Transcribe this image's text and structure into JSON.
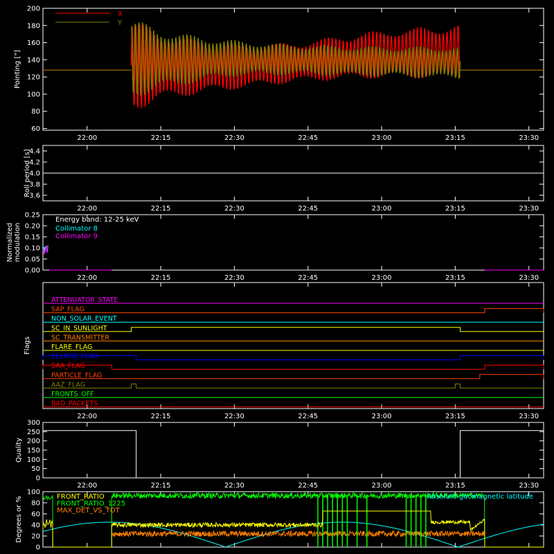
{
  "colors": {
    "background": "#000000",
    "axis": "#ffffff",
    "red": "#ff0000",
    "olive": "#808000",
    "cyan": "#00ffff",
    "magenta": "#ff00ff",
    "yellow": "#ffff00",
    "green": "#00ff00",
    "orange": "#ff8000",
    "blue": "#0000ff",
    "orangered": "#ff4500"
  },
  "time_axis": {
    "range": [
      "21:51",
      "23:33"
    ],
    "ticks": [
      "22:00",
      "22:15",
      "22:30",
      "22:45",
      "23:00",
      "23:15",
      "23:30"
    ]
  },
  "chart_data": [
    {
      "id": "pointing",
      "type": "line",
      "ylabel": "Pointing [\"]",
      "ylim": [
        58,
        200
      ],
      "yticks": [
        "60",
        "80",
        "100",
        "120",
        "140",
        "160",
        "180",
        "200"
      ],
      "legend": "top-left",
      "series": [
        {
          "name": "X",
          "color": "#ff0000",
          "baseline": 128,
          "active_start": "22:09",
          "active_end": "23:16",
          "upper_env": [
            [
              22.15,
              186
            ],
            [
              22.3,
              168
            ],
            [
              22.5,
              158
            ],
            [
              22.7,
              160
            ],
            [
              22.85,
              168
            ],
            [
              23.0,
              175
            ],
            [
              23.2,
              180
            ],
            [
              23.25,
              182
            ]
          ],
          "lower_env": [
            [
              22.15,
              80
            ],
            [
              22.3,
              95
            ],
            [
              22.5,
              105
            ],
            [
              22.7,
              113
            ],
            [
              22.85,
              116
            ],
            [
              23.0,
              118
            ],
            [
              23.2,
              118
            ],
            [
              23.25,
              118
            ]
          ]
        },
        {
          "name": "Y",
          "color": "#808000",
          "baseline": 128,
          "active_start": "22:09",
          "active_end": "23:16",
          "upper_env": [
            [
              22.15,
              188
            ],
            [
              22.3,
              172
            ],
            [
              22.5,
              163
            ],
            [
              22.7,
              158
            ],
            [
              22.85,
              157
            ],
            [
              23.0,
              156
            ],
            [
              23.2,
              156
            ],
            [
              23.25,
              156
            ]
          ],
          "lower_env": [
            [
              22.15,
              95
            ],
            [
              22.3,
              108
            ],
            [
              22.5,
              120
            ],
            [
              22.7,
              122
            ],
            [
              22.85,
              121
            ],
            [
              23.0,
              120
            ],
            [
              23.2,
              118
            ],
            [
              23.25,
              117
            ]
          ]
        }
      ]
    },
    {
      "id": "roll",
      "type": "line",
      "ylabel": "Roll period [s]",
      "ylim": [
        3.5,
        4.5
      ],
      "yticks": [
        "3.6",
        "3.8",
        "4.0",
        "4.2",
        "4.4"
      ],
      "series": [
        {
          "name": "",
          "color": "#ffffff",
          "value": 4.0
        }
      ]
    },
    {
      "id": "modulation",
      "type": "line",
      "ylabel_line1": "Normalized",
      "ylabel_line2": "modulation",
      "ylim": [
        0,
        0.25
      ],
      "yticks": [
        "0.00",
        "0.05",
        "0.10",
        "0.15",
        "0.20",
        "0.25"
      ],
      "annotation": "Energy band: 12-25 keV",
      "legend": "top-left",
      "active_ranges": [
        [
          "21:51",
          "21:52"
        ],
        [
          "22:05",
          "23:21"
        ]
      ],
      "series": [
        {
          "name": "Collimator 8",
          "color": "#00ffff",
          "mean": 0.095,
          "spread": 0.022
        },
        {
          "name": "Collimator 9",
          "color": "#ff00ff",
          "mean": 0.092,
          "spread": 0.02
        }
      ]
    },
    {
      "id": "flags",
      "type": "line",
      "ylabel": "Flags",
      "series": [
        {
          "name": "ATTENUATOR_STATE",
          "color": "#ff00ff",
          "steps": []
        },
        {
          "name": "SAP_FLAG",
          "color": "#ff4500",
          "steps": [
            {
              "from": "23:21",
              "to": "23:33"
            }
          ]
        },
        {
          "name": "NON_SOLAR_EVENT",
          "color": "#00ffff",
          "steps": []
        },
        {
          "name": "SC_IN_SUNLIGHT",
          "color": "#ffff00",
          "steps": [
            {
              "from": "22:09",
              "to": "23:16"
            }
          ]
        },
        {
          "name": "SC_TRANSMITTER",
          "color": "#ff8000",
          "steps": []
        },
        {
          "name": "FLARE_FLAG",
          "color": "#ffff00",
          "steps": []
        },
        {
          "name": "ECLIPSE_FLAG",
          "color": "#0000ff",
          "steps": [
            {
              "from": "21:51",
              "to": "22:10"
            },
            {
              "from": "23:16",
              "to": "23:33"
            }
          ]
        },
        {
          "name": "SAA_FLAG",
          "color": "#ff0000",
          "steps": [
            {
              "from": "21:51",
              "to": "22:05"
            },
            {
              "from": "23:21",
              "to": "23:33"
            }
          ]
        },
        {
          "name": "PARTICLE_FLAG",
          "color": "#ff4500",
          "steps": [
            {
              "from": "23:20",
              "to": "23:33"
            }
          ]
        },
        {
          "name": "AAZ_FLAG",
          "color": "#808000",
          "steps": [
            {
              "from": "22:09",
              "to": "22:10"
            },
            {
              "from": "23:15",
              "to": "23:16"
            }
          ]
        },
        {
          "name": "FRONTS_OFF",
          "color": "#00ff00",
          "steps": []
        },
        {
          "name": "BAD_PACKETS",
          "color": "#ff0000",
          "steps": []
        }
      ]
    },
    {
      "id": "quality",
      "type": "line",
      "ylabel": "Quality",
      "ylim": [
        0,
        300
      ],
      "yticks": [
        "0",
        "50",
        "100",
        "150",
        "200",
        "250",
        "300"
      ],
      "series": [
        {
          "name": "",
          "color": "#ffffff",
          "segments": [
            [
              "21:51",
              "22:10",
              256
            ],
            [
              "22:10",
              "23:16",
              0
            ],
            [
              "23:16",
              "23:33",
              256
            ]
          ]
        }
      ]
    },
    {
      "id": "degrees",
      "type": "line",
      "ylabel": "Degrees or %",
      "ylim": [
        0,
        100
      ],
      "yticks": [
        "0",
        "20",
        "40",
        "60",
        "80",
        "100"
      ],
      "legend": "top-left",
      "series": [
        {
          "name": "FRONT_RATIO",
          "color": "#ffff00"
        },
        {
          "name": "FRONT_RATIO_1225",
          "color": "#00ff00"
        },
        {
          "name": "MAX_DET_VS_TOT",
          "color": "#ff8000"
        },
        {
          "name": "Absolute geomagnetic latitude",
          "color": "#00ffff"
        }
      ]
    }
  ]
}
